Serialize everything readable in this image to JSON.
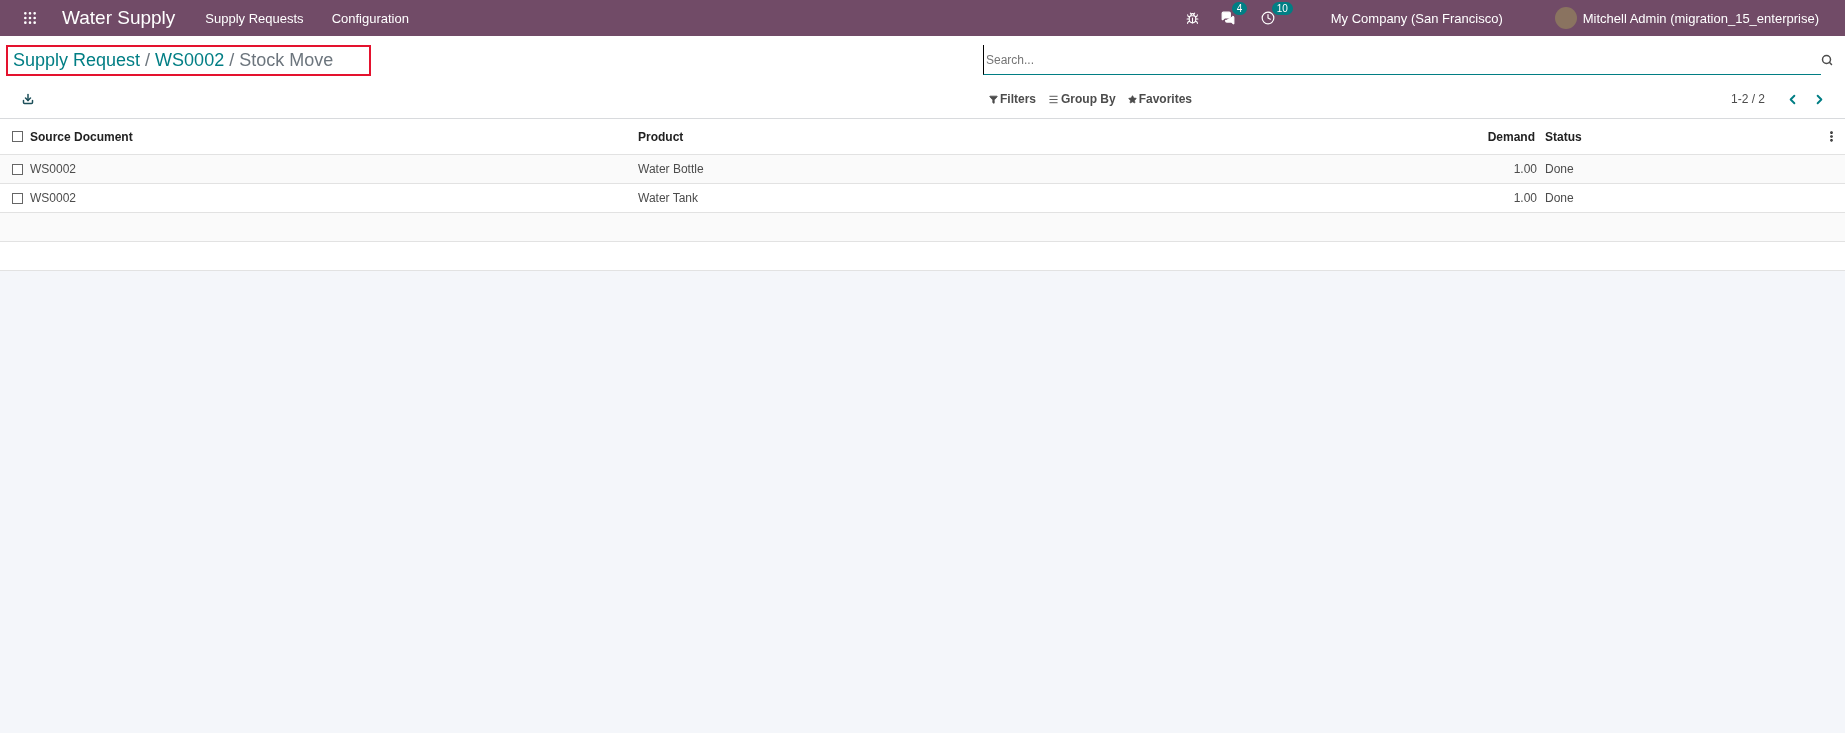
{
  "navbar": {
    "app_name": "Water Supply",
    "menus": [
      "Supply Requests",
      "Configuration"
    ],
    "messages_count": "4",
    "activities_count": "10",
    "company": "My Company (San Francisco)",
    "user": "Mitchell Admin (migration_15_enterprise)"
  },
  "breadcrumb": {
    "highlighted": true,
    "separator": "/",
    "items": [
      {
        "label": "Supply Request",
        "current": false
      },
      {
        "label": "WS0002",
        "current": false
      },
      {
        "label": "Stock Move",
        "current": true
      }
    ]
  },
  "search": {
    "placeholder": "Search..."
  },
  "filters": [
    {
      "kind": "filter",
      "label": "Filters"
    },
    {
      "kind": "group",
      "label": "Group By"
    },
    {
      "kind": "favorite",
      "label": "Favorites"
    }
  ],
  "pager": {
    "range": "1-2 / 2"
  },
  "table": {
    "select_all_checked": false,
    "columns": [
      "Source Document",
      "Product",
      "Demand",
      "Status"
    ],
    "rows": [
      {
        "checked": false,
        "cells": [
          "WS0002",
          "Water Bottle",
          "1.00",
          "Done"
        ]
      },
      {
        "checked": false,
        "cells": [
          "WS0002",
          "Water Tank",
          "1.00",
          "Done"
        ]
      }
    ]
  }
}
